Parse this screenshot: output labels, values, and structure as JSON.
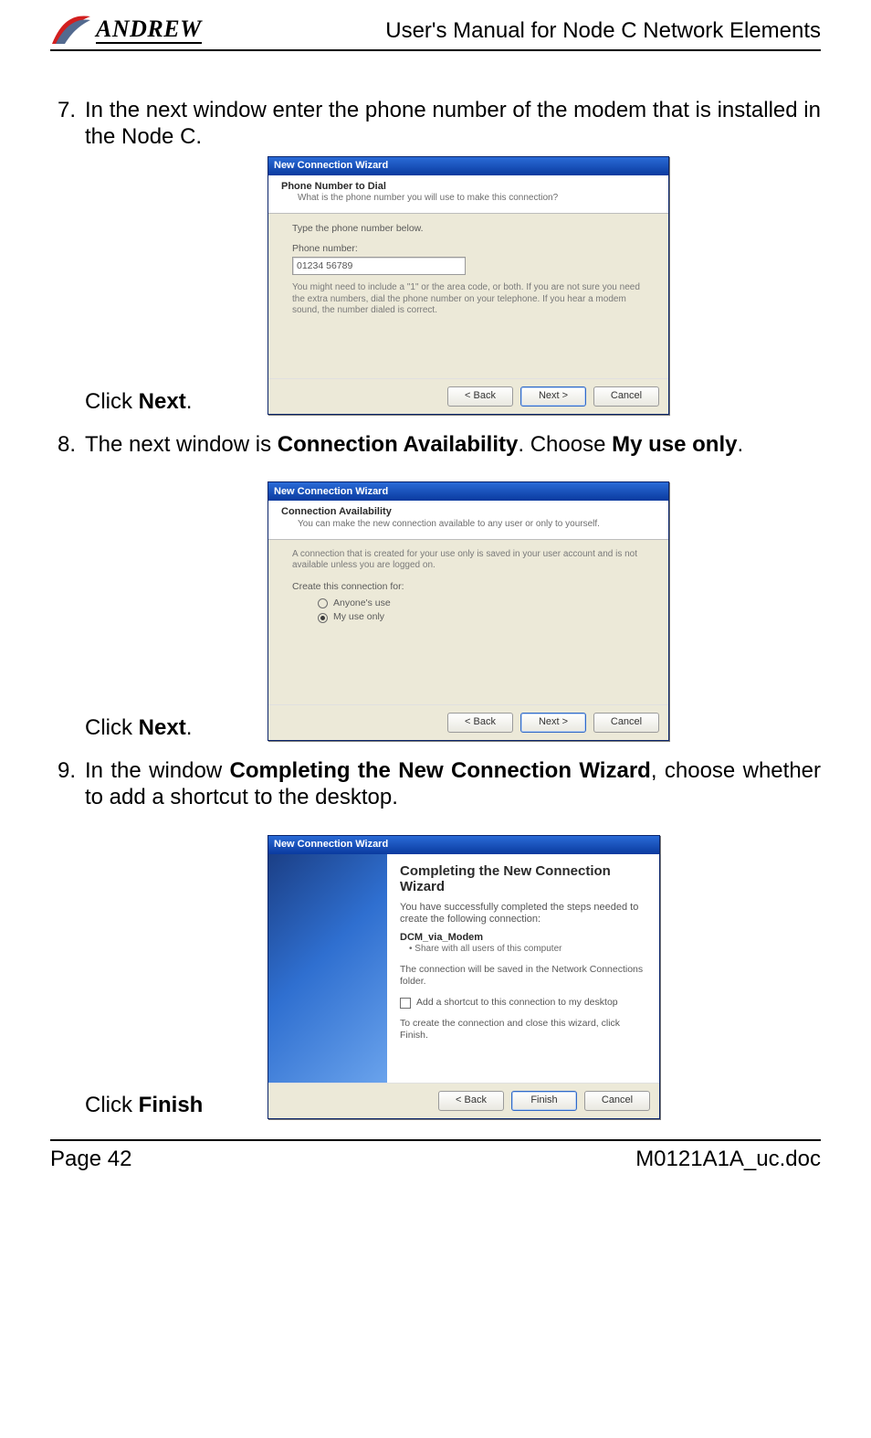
{
  "header": {
    "logo_text": "ANDREW",
    "title": "User's Manual for Node C Network Elements"
  },
  "steps": {
    "s7": {
      "num": "7.",
      "text_a": "In the next window enter the phone number of the modem that is installed in the Node C.",
      "click_a": "Click ",
      "click_b": "Next",
      "click_c": "."
    },
    "s8": {
      "num": "8.",
      "text_a": "The next window is ",
      "text_b": "Connection Availability",
      "text_c": ". Choose ",
      "text_d": "My use only",
      "text_e": ".",
      "click_a": "Click ",
      "click_b": "Next",
      "click_c": "."
    },
    "s9": {
      "num": "9.",
      "text_a": "In the window ",
      "text_b": "Completing the New Connection Wizard",
      "text_c": ", choose whether to add a shortcut to the desktop.",
      "click_a": "Click ",
      "click_b": "Finish"
    }
  },
  "wizard1": {
    "titlebar": "New Connection Wizard",
    "h1": "Phone Number to Dial",
    "h2": "What is the phone number you will use to make this connection?",
    "body_lbl1": "Type the phone number below.",
    "body_lbl2": "Phone number:",
    "input_value": "01234 56789",
    "hint": "You might need to include a \"1\" or the area code, or both. If you are not sure you need the extra numbers, dial the phone number on your telephone. If you hear a modem sound, the number dialed is correct.",
    "btn_back": "< Back",
    "btn_next": "Next >",
    "btn_cancel": "Cancel"
  },
  "wizard2": {
    "titlebar": "New Connection Wizard",
    "h1": "Connection Availability",
    "h2": "You can make the new connection available to any user or only to yourself.",
    "body_intro": "A connection that is created for your use only is saved in your user account and is not available unless you are logged on.",
    "group_lbl": "Create this connection for:",
    "radio1": "Anyone's use",
    "radio2": "My use only",
    "btn_back": "< Back",
    "btn_next": "Next >",
    "btn_cancel": "Cancel"
  },
  "wizard3": {
    "titlebar": "New Connection Wizard",
    "title": "Completing the New Connection Wizard",
    "line1": "You have successfully completed the steps needed to create the following connection:",
    "conn_name": "DCM_via_Modem",
    "bullet": "• Share with all users of this computer",
    "line2": "The connection will be saved in the Network Connections folder.",
    "check_label": "Add a shortcut to this connection to my desktop",
    "line3": "To create the connection and close this wizard, click Finish.",
    "btn_back": "< Back",
    "btn_finish": "Finish",
    "btn_cancel": "Cancel"
  },
  "footer": {
    "page": "Page 42",
    "doc": "M0121A1A_uc.doc"
  }
}
